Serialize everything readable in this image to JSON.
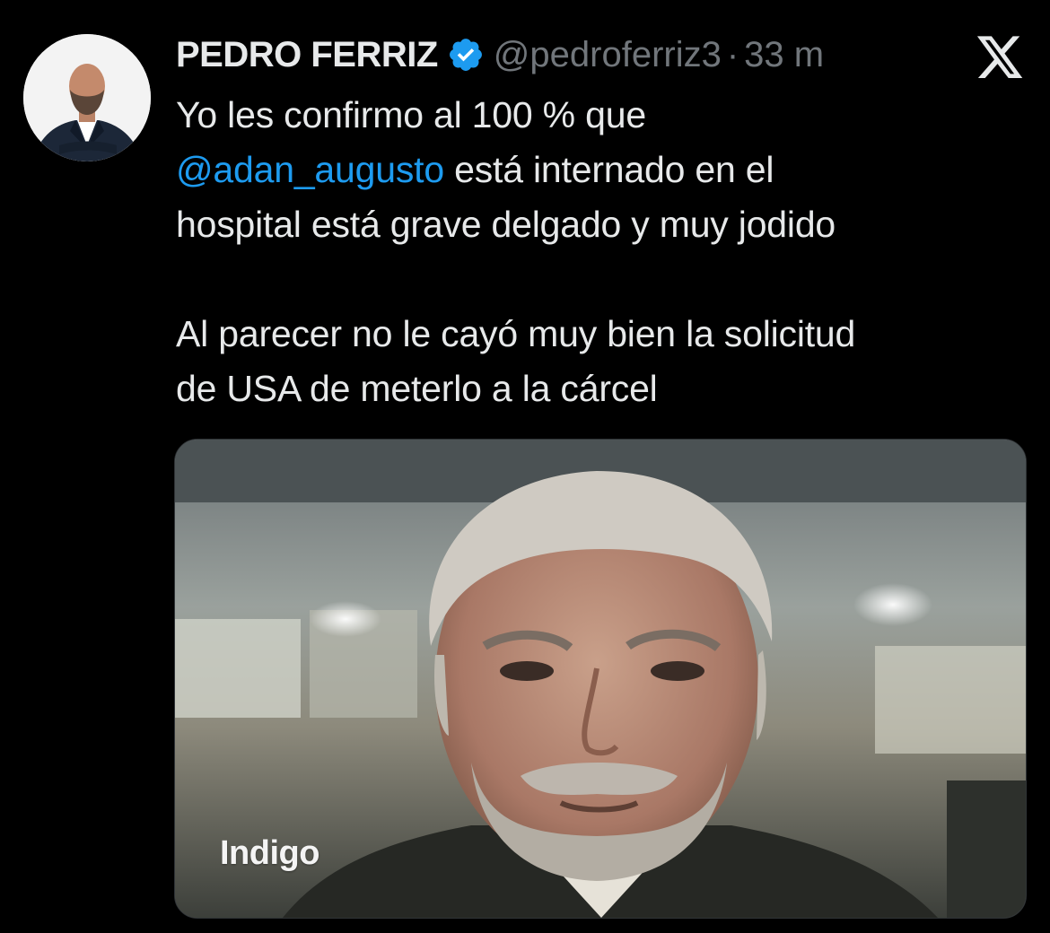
{
  "author": {
    "display_name": "PEDRO FERRIZ",
    "handle": "@pedroferriz3",
    "separator": "·",
    "timestamp": "33 m",
    "verified": true,
    "avatar_icon": "profile-photo"
  },
  "tweet": {
    "line1_prefix": "Yo les confirmo al 100 % que",
    "mention": "@adan_augusto",
    "line1_suffix": " está internado en el",
    "line3": "hospital está grave delgado y muy jodido",
    "paragraph2_line1": "Al parecer no le cayó muy bien la solicitud",
    "paragraph2_line2": "de USA de meterlo a la cárcel"
  },
  "media": {
    "watermark": "Indigo"
  },
  "colors": {
    "background": "#000000",
    "text": "#e7e9ea",
    "secondary": "#71767b",
    "link": "#1d9bf0",
    "verified_badge": "#1d9bf0"
  },
  "icons": {
    "verified": "verified-badge-icon",
    "brand": "x-logo-icon"
  }
}
